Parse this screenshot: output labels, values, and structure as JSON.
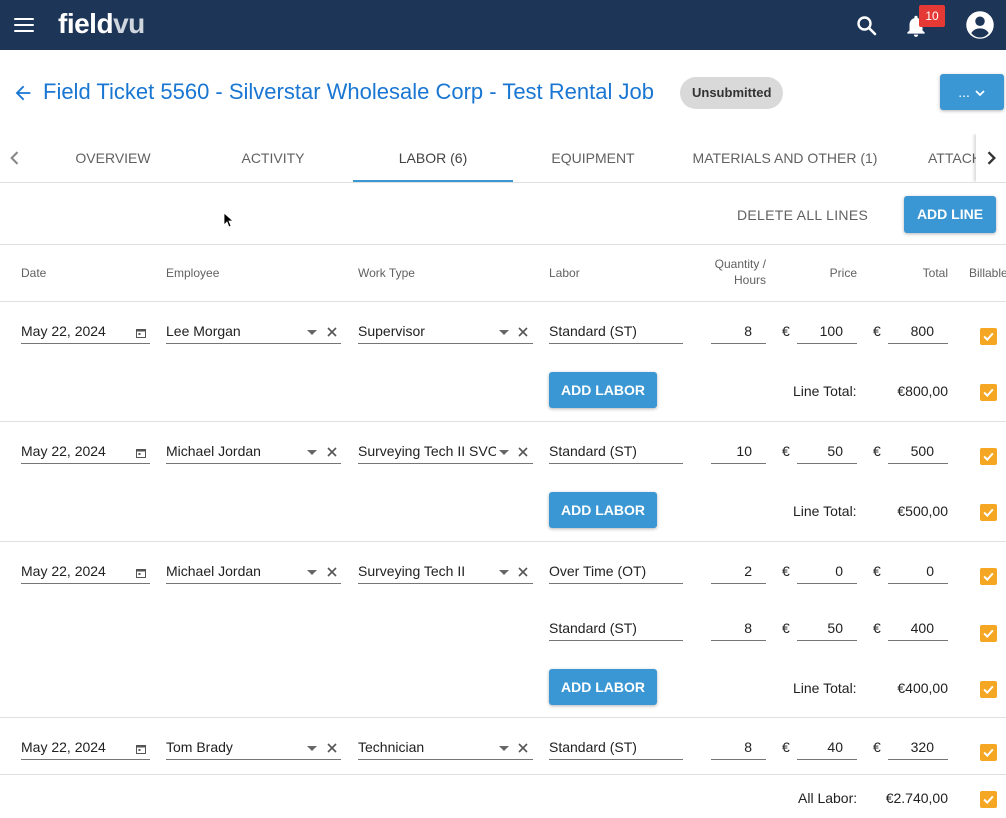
{
  "app": {
    "logo_field": "field",
    "logo_vu": "vu",
    "notification_count": "10"
  },
  "header": {
    "title": "Field Ticket 5560 - Silverstar Wholesale Corp - Test Rental Job",
    "status": "Unsubmitted",
    "more_label": "..."
  },
  "tabs": [
    {
      "label": "OVERVIEW"
    },
    {
      "label": "ACTIVITY"
    },
    {
      "label": "LABOR (6)"
    },
    {
      "label": "EQUIPMENT"
    },
    {
      "label": "MATERIALS AND OTHER (1)"
    },
    {
      "label": "ATTACH"
    }
  ],
  "toolbar": {
    "delete_all": "DELETE ALL LINES",
    "add_line": "ADD LINE"
  },
  "columns": {
    "date": "Date",
    "employee": "Employee",
    "work_type": "Work Type",
    "labor": "Labor",
    "qty_line1": "Quantity /",
    "qty_line2": "Hours",
    "price": "Price",
    "total": "Total",
    "billable": "Billable"
  },
  "currency": "€",
  "add_labor_label": "ADD LABOR",
  "line_total_label": "Line Total:",
  "all_labor_label": "All Labor:",
  "all_labor_value": "€2.740,00",
  "lines": [
    {
      "date": "May 22, 2024",
      "employee": "Lee Morgan",
      "work_type": "Supervisor",
      "labor": [
        {
          "type": "Standard (ST)",
          "qty": "8",
          "price": "100",
          "total": "800"
        }
      ],
      "line_total": "€800,00"
    },
    {
      "date": "May 22, 2024",
      "employee": "Michael Jordan",
      "work_type": "Surveying Tech II SVO",
      "labor": [
        {
          "type": "Standard (ST)",
          "qty": "10",
          "price": "50",
          "total": "500"
        }
      ],
      "line_total": "€500,00"
    },
    {
      "date": "May 22, 2024",
      "employee": "Michael Jordan",
      "work_type": "Surveying Tech II",
      "labor": [
        {
          "type": "Over Time (OT)",
          "qty": "2",
          "price": "0",
          "total": "0"
        },
        {
          "type": "Standard (ST)",
          "qty": "8",
          "price": "50",
          "total": "400"
        }
      ],
      "line_total": "€400,00"
    },
    {
      "date": "May 22, 2024",
      "employee": "Tom Brady",
      "work_type": "Technician",
      "labor": [
        {
          "type": "Standard (ST)",
          "qty": "8",
          "price": "40",
          "total": "320"
        }
      ]
    }
  ],
  "colors": {
    "topbar": "#1d3557",
    "accent": "#3a97d4",
    "title": "#1976d2",
    "checkbox": "#f5a623",
    "badge": "#e53935"
  }
}
